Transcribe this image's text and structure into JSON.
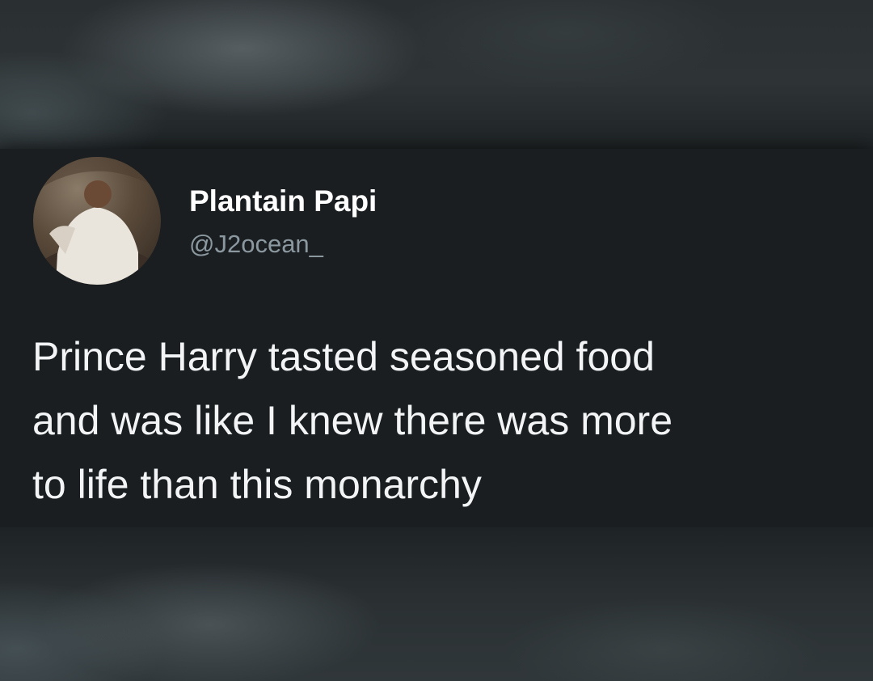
{
  "tweet": {
    "display_name": "Plantain Papi",
    "handle": "@J2ocean_",
    "text_lines": [
      "Prince Harry tasted seasoned food",
      "and was like I knew there was more",
      "to life than this monarchy"
    ],
    "avatar": "user-avatar-photo"
  },
  "colors": {
    "card_background": "#1a1e20",
    "name_text": "#ffffff",
    "handle_text": "#8b98a0",
    "body_text": "#f2f4f5"
  }
}
